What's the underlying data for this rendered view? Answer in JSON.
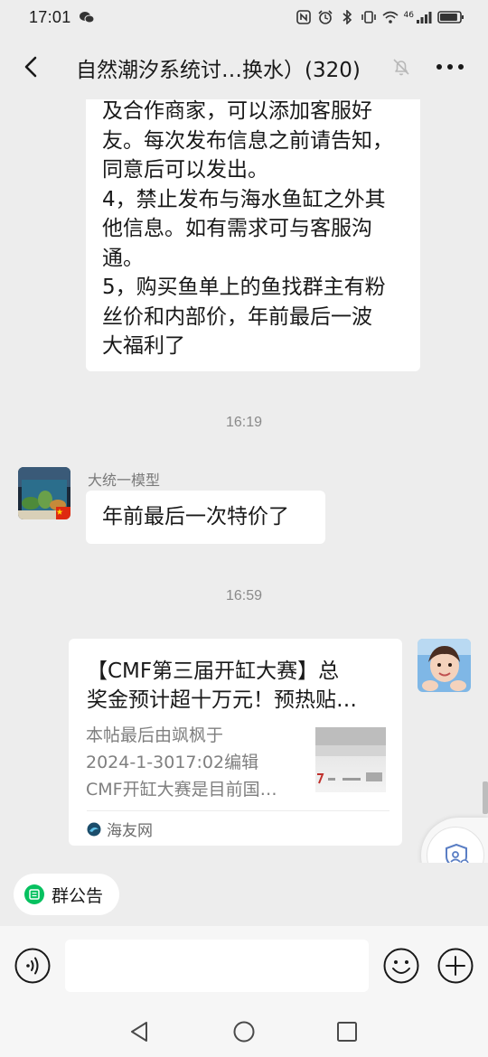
{
  "status_bar": {
    "time": "17:01",
    "network": "46",
    "battery_level": 0.9
  },
  "header": {
    "title": "自然潮汐系统讨…换水）(320)",
    "back_icon": "chevron-left-icon",
    "mute_icon": "bell-off-icon",
    "more_icon": "more-horizontal-icon"
  },
  "messages": {
    "rules": {
      "lines": [
        "及合作商家，可以添加客服好",
        "友。每次发布信息之前请告知，",
        "同意后可以发出。",
        "4，禁止发布与海水鱼缸之外其",
        "他信息。如有需求可与客服沟",
        "通。",
        "5，购买鱼单上的鱼找群主有粉",
        "丝价和内部价，年前最后一波",
        "大福利了"
      ]
    },
    "time_1": "16:19",
    "msg_2": {
      "sender": "大统一模型",
      "text": "年前最后一次特价了"
    },
    "time_2": "16:59",
    "link_card": {
      "title_lines": [
        "【CMF第三届开缸大赛】总",
        "奖金预计超十万元！预热贴…"
      ],
      "desc_lines": [
        "本帖最后由飒枫于",
        "2024-1-3017:02编辑",
        "CMF开缸大赛是目前国…"
      ],
      "source": "海友网"
    }
  },
  "announcement": {
    "label": "群公告"
  },
  "input": {
    "placeholder": "",
    "voice_icon": "voice-icon",
    "emoji_icon": "emoji-icon",
    "plus_icon": "plus-icon"
  },
  "colors": {
    "background": "#ededed",
    "bubble": "#ffffff",
    "accent_green": "#07c160"
  }
}
